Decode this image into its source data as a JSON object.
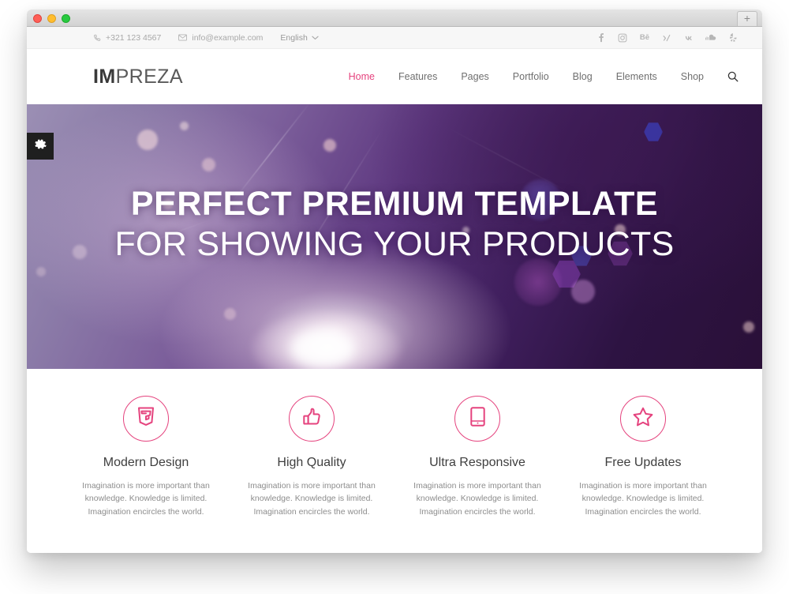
{
  "window": {
    "newtab_label": "+",
    "traffic_lights": [
      "close-red",
      "minimize-yellow",
      "maximize-green"
    ]
  },
  "topbar": {
    "phone": "+321 123 4567",
    "email": "info@example.com",
    "language": "English",
    "phone_icon": "phone-icon",
    "email_icon": "envelope-icon",
    "lang_chevron_icon": "chevron-down-icon",
    "social": [
      {
        "name": "facebook",
        "glyph": "f"
      },
      {
        "name": "instagram",
        "glyph": ""
      },
      {
        "name": "behance",
        "glyph": "Bē"
      },
      {
        "name": "xing",
        "glyph": "X"
      },
      {
        "name": "vk",
        "glyph": "vk"
      },
      {
        "name": "soundcloud",
        "glyph": ""
      },
      {
        "name": "yelp",
        "glyph": ""
      }
    ]
  },
  "header": {
    "logo_bold": "IM",
    "logo_light": "PREZA",
    "nav": [
      {
        "label": "Home",
        "active": true
      },
      {
        "label": "Features",
        "active": false
      },
      {
        "label": "Pages",
        "active": false
      },
      {
        "label": "Portfolio",
        "active": false
      },
      {
        "label": "Blog",
        "active": false
      },
      {
        "label": "Elements",
        "active": false
      },
      {
        "label": "Shop",
        "active": false
      }
    ],
    "search_icon": "search-icon"
  },
  "hero": {
    "gear_icon": "gear-icon",
    "headline_bold": "PERFECT PREMIUM TEMPLATE",
    "headline_light": "FOR SHOWING YOUR PRODUCTS"
  },
  "features": [
    {
      "icon": "html5-shield-icon",
      "title": "Modern Design",
      "desc": "Imagination is more important than knowledge. Knowledge is limited. Imagination encircles the world."
    },
    {
      "icon": "thumbs-up-icon",
      "title": "High Quality",
      "desc": "Imagination is more important than knowledge. Knowledge is limited. Imagination encircles the world."
    },
    {
      "icon": "tablet-device-icon",
      "title": "Ultra Responsive",
      "desc": "Imagination is more important than knowledge. Knowledge is limited. Imagination encircles the world."
    },
    {
      "icon": "star-outline-icon",
      "title": "Free Updates",
      "desc": "Imagination is more important than knowledge. Knowledge is limited. Imagination encircles the world."
    }
  ],
  "colors": {
    "accent_pink": "#e5437e",
    "text_dark": "#3e3e3e",
    "text_muted": "#8d8d8d",
    "topbar_bg": "#f7f7f7",
    "gear_tab_bg": "#1f1f1f"
  }
}
